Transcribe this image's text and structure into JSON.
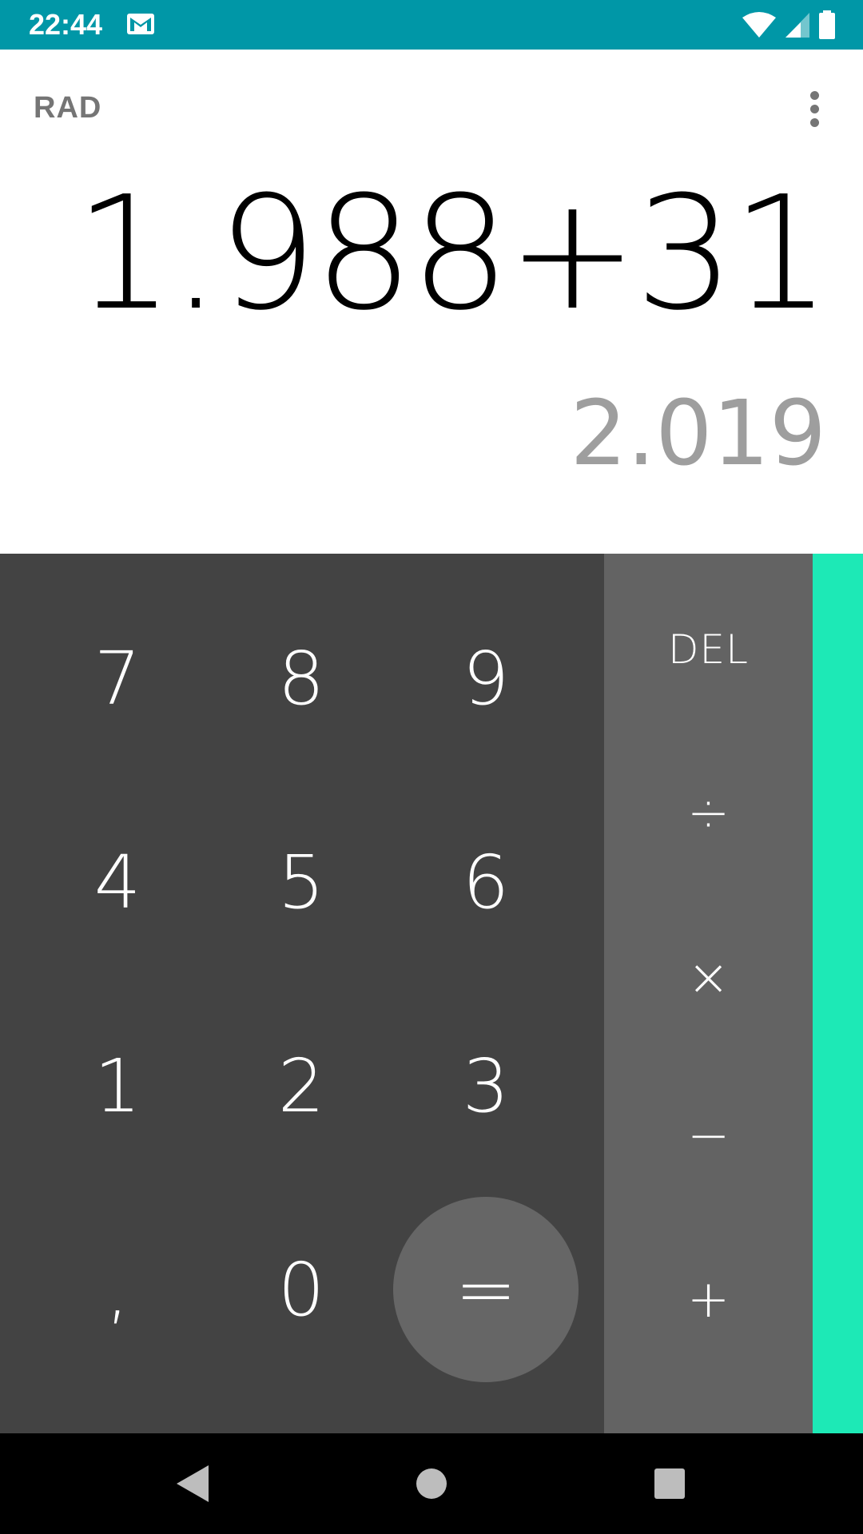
{
  "status_bar": {
    "time": "22:44",
    "background": "#0097a7",
    "icons": [
      "gmail-icon",
      "wifi-icon",
      "signal-icon",
      "battery-icon"
    ]
  },
  "display": {
    "angle_mode": "RAD",
    "formula": "1.988+31",
    "result": "2.019",
    "overflow_icon": "more-vert-icon"
  },
  "keypad": {
    "digits": {
      "seven": "7",
      "eight": "8",
      "nine": "9",
      "four": "4",
      "five": "5",
      "six": "6",
      "one": "1",
      "two": "2",
      "three": "3",
      "decimal": ",",
      "zero": "0"
    },
    "equals": "=",
    "operators": {
      "del": "DEL",
      "divide": "÷",
      "multiply": "×",
      "subtract": "−",
      "add": "+"
    },
    "colors": {
      "numeric_pad": "#434343",
      "operator_pad": "#636363",
      "advanced_pad": "#1de9b6",
      "equals_circle": "#666666"
    }
  },
  "nav_bar": {
    "icons": [
      "back-icon",
      "home-icon",
      "recents-icon"
    ]
  }
}
